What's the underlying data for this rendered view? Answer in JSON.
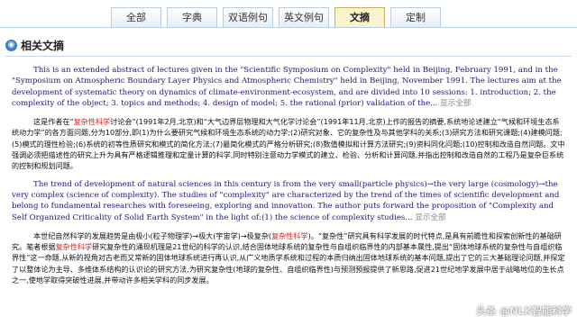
{
  "tabs": [
    {
      "label": "全部",
      "width": 56
    },
    {
      "label": "字典",
      "width": 56
    },
    {
      "label": "双语例句",
      "width": 56
    },
    {
      "label": "英文例句",
      "width": 56
    },
    {
      "label": "文摘",
      "width": 56,
      "active": true
    },
    {
      "label": "定制",
      "width": 56
    }
  ],
  "section": {
    "title": "相关文摘",
    "icon": "book-icon"
  },
  "paragraphs": [
    {
      "lang": "en",
      "segments": [
        {
          "text": "This is an extended abstract of lectures given in the \"Scientific Symposium on Complexity\" held in Beijing, February 1991, and in the \"Symposium on Atmospheric Boundary Layer Physics and Atmospheric Chemistry\" held in Beijing, November 1991. The lectures aim at the development of systematic theory on dynamics of climate-environment-ecosystem, and are divided into 10 sessions: 1. introduction; 2. the complexity of the object; 3. topics and methods; 4. design of model; 5. the rational (prior) validation of the..."
        }
      ],
      "more": "显示全部"
    },
    {
      "lang": "zh",
      "segments": [
        {
          "text": "这是作者在“"
        },
        {
          "text": "复杂性科学",
          "hl": true
        },
        {
          "text": "讨论会”(1991年2月,北京)和“大气边界层物理和大气化学讨论会”(1991年11月,北京)上作的报告的摘要,系统地论述建立“气候和环境生态系统动力学”的各方面问题,分为10部分,即(1)为什么要研究气候和环境生态系统的动力学;(2)研究对象、它的复杂性及与其他学科的关系;(3)研究方法和研究课题;(4)建模问题;(5)模式的理性检验;(6)系统的初等性质研究和模式的简化方法;(7)最简化模式的严格分析研究;(8)数值模拟和计算方法研究;(9)资料同化问题;(10)控制和改造自然问题。文中强调必须把描述性的研究上升为具有严格逻辑推理和定量计算的科学,同时特别注意动力学模式的建立、检验、分析和计算问题,并指出控制和改造自然的工程乃是复杂巨系统的控制和规划问题。"
        }
      ]
    },
    {
      "lang": "en",
      "segments": [
        {
          "text": "The trend of development of natural sciences in this century is from the very small(particle physics)→the very large (cosmology)→the very complex (science of complexity). The studies of \"complexity\" are characterized by the trend of the times of scientific development and belong to fundamental researches with foreseeing, exploring and innovation. The author puts forward the proposition of \"Complexity and Self Organized Criticality of Solid Earth System\" in the light of:(1) the science of complexity studies..."
        }
      ],
      "more": "显示全部"
    },
    {
      "lang": "zh",
      "segments": [
        {
          "text": "本世纪自然科学的发展趋势是由极小(粒子物理学)→极大(宇宙学)→极复杂("
        },
        {
          "text": "复杂性科学",
          "hl": true
        },
        {
          "text": ")。“复杂性”研究具有科学发展的时代特点,是具有前瞻性和探索创新性的基础研究。笔者根据"
        },
        {
          "text": "复杂性科学",
          "hl": true
        },
        {
          "text": "研究复杂性的涌现机理是21世纪的科学的认识,结合固体地球系统的复杂性与自组织临界性的内部基本属性,提出“固体地球系统的复杂性与自组织临界性”这一命题,从新的视角对古老而又常新的固体地球系统进行再认识,从广义地质学系统和过程的本质归纳出固体地球系统的基本问题,提出了它的三大基础理论问题,并探定了以整体论为主导、多维体系结构的认识论的研究方法,为研究复杂性(地球的复杂性、自组织临界性)与预测预报提供了新思路,促进21世纪地学发展中居于战略地位的生长点之一,使地学取得突破性进展,并带动许多相关学科的同步发展。"
        }
      ]
    }
  ],
  "watermark": "头条 @NLK智能科学"
}
